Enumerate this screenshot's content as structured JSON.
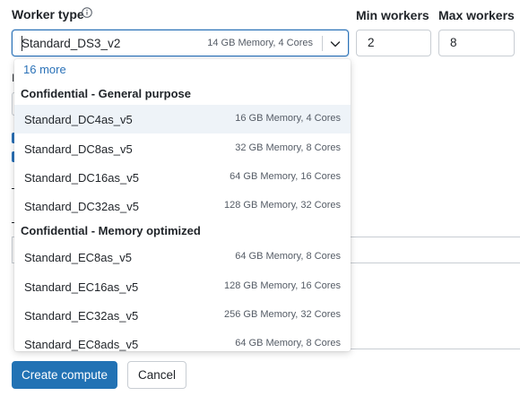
{
  "form": {
    "worker_type_label": "Worker type",
    "min_workers_label": "Min workers",
    "max_workers_label": "Max workers",
    "min_workers_value": "2",
    "max_workers_value": "8",
    "selected": {
      "name": "Standard_DS3_v2",
      "spec": "14 GB Memory, 4 Cores"
    }
  },
  "background_fragment": {
    "letter": "I"
  },
  "dropdown": {
    "more_label": "16 more",
    "groups": [
      {
        "header": "Confidential - General purpose",
        "options": [
          {
            "name": "Standard_DC4as_v5",
            "spec": "16 GB Memory, 4 Cores"
          },
          {
            "name": "Standard_DC8as_v5",
            "spec": "32 GB Memory, 8 Cores"
          },
          {
            "name": "Standard_DC16as_v5",
            "spec": "64 GB Memory, 16 Cores"
          },
          {
            "name": "Standard_DC32as_v5",
            "spec": "128 GB Memory, 32 Cores"
          }
        ]
      },
      {
        "header": "Confidential - Memory optimized",
        "options": [
          {
            "name": "Standard_EC8as_v5",
            "spec": "64 GB Memory, 8 Cores"
          },
          {
            "name": "Standard_EC16as_v5",
            "spec": "128 GB Memory, 16 Cores"
          },
          {
            "name": "Standard_EC32as_v5",
            "spec": "256 GB Memory, 32 Cores"
          },
          {
            "name": "Standard_EC8ads_v5",
            "spec": "64 GB Memory, 8 Cores"
          }
        ]
      }
    ]
  },
  "footer": {
    "create_label": "Create compute",
    "cancel_label": "Cancel"
  },
  "colors": {
    "accent": "#2272b4",
    "link": "#2b72b8",
    "highlight_row": "#eef3f8"
  },
  "icons": [
    "info-icon",
    "chevron-down-icon"
  ]
}
